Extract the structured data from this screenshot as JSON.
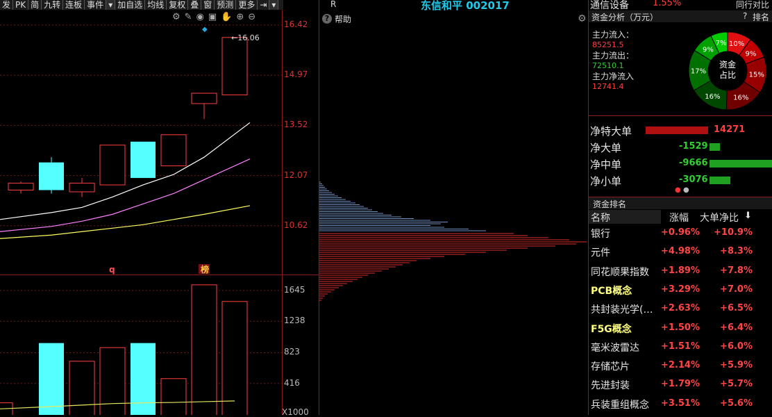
{
  "toolbar": {
    "items": [
      "发",
      "PK",
      "简",
      "九转",
      "连板",
      "事件",
      "▾",
      "加自选",
      "均线",
      "复权",
      "叠",
      "窗",
      "预测",
      "更多",
      "⇥",
      "▾"
    ]
  },
  "chart_icons": [
    "gear-icon",
    "pen-icon",
    "eye-icon",
    "trash-icon",
    "hand-icon",
    "plus-icon",
    "minus-icon"
  ],
  "chart_data": [
    {
      "type": "candlestick",
      "name": "price",
      "y_ticks": [
        "16.42",
        "14.97",
        "13.52",
        "12.07",
        "10.62"
      ],
      "ylim": [
        9.17,
        16.42
      ],
      "max_label": "16.06",
      "candles": [
        {
          "open": 11.65,
          "close": 11.85,
          "high": 11.9,
          "low": 11.55,
          "dir": "up"
        },
        {
          "open": 12.45,
          "close": 11.65,
          "high": 12.6,
          "low": 11.55,
          "dir": "down"
        },
        {
          "open": 11.6,
          "close": 11.85,
          "high": 12.0,
          "low": 11.45,
          "dir": "up"
        },
        {
          "open": 11.8,
          "close": 12.95,
          "high": 12.95,
          "low": 11.8,
          "dir": "up"
        },
        {
          "open": 13.05,
          "close": 12.0,
          "high": 13.05,
          "low": 12.0,
          "dir": "down"
        },
        {
          "open": 12.35,
          "close": 13.25,
          "high": 13.25,
          "low": 12.35,
          "dir": "up"
        },
        {
          "open": 14.15,
          "close": 14.45,
          "high": 14.45,
          "low": 13.7,
          "dir": "up"
        },
        {
          "open": 14.4,
          "close": 16.06,
          "high": 16.06,
          "low": 14.4,
          "dir": "up"
        }
      ],
      "ma_lines": [
        {
          "color": "#ffffff",
          "values": [
            10.8,
            11.0,
            11.15,
            11.45,
            11.8,
            12.1,
            12.6,
            13.6
          ],
          "x": [
            0,
            1,
            2,
            3,
            4,
            5,
            6,
            7.5
          ]
        },
        {
          "color": "#ff80ff",
          "values": [
            10.45,
            10.6,
            10.75,
            10.95,
            11.25,
            11.55,
            11.95,
            12.55
          ],
          "x": [
            0,
            1,
            2,
            3,
            4,
            5,
            6,
            7.5
          ]
        },
        {
          "color": "#ffff60",
          "values": [
            10.25,
            10.35,
            10.45,
            10.55,
            10.65,
            10.8,
            10.95,
            11.2
          ],
          "x": [
            0,
            1,
            2,
            3,
            4,
            5,
            6,
            7.5
          ]
        }
      ],
      "markers": [
        {
          "label": "q",
          "index": 3
        },
        {
          "label": "榜",
          "index": 6
        }
      ]
    },
    {
      "type": "bar",
      "name": "volume",
      "y_ticks": [
        "1645",
        "1238",
        "823",
        "416"
      ],
      "unit_label": "X1000",
      "ylim": [
        0,
        1800
      ],
      "values": [
        160,
        950,
        710,
        890,
        950,
        480,
        1720,
        1500
      ],
      "dirs": [
        "up",
        "down",
        "up",
        "up",
        "down",
        "up",
        "up",
        "up"
      ],
      "ma_values": [
        80,
        110,
        130,
        150,
        160,
        165,
        175,
        185
      ]
    },
    {
      "type": "bar",
      "name": "chip-distribution",
      "orientation": "horizontal",
      "blue": [
        2,
        4,
        6,
        8,
        11,
        14,
        18,
        22,
        27,
        32,
        38,
        45,
        52,
        58,
        64,
        70,
        76,
        84,
        92,
        104,
        118,
        136,
        160,
        185,
        175,
        160,
        180,
        215,
        240
      ],
      "red": [
        280,
        300,
        330,
        360,
        385,
        370,
        340,
        300,
        270,
        240,
        210,
        180,
        160,
        140,
        130,
        120,
        110,
        100,
        90,
        80,
        70,
        62,
        55,
        48,
        40,
        34,
        28,
        22,
        17,
        12,
        8,
        5,
        3
      ]
    }
  ],
  "middle": {
    "r_label": "R",
    "stock_title": "东信和平 002017",
    "help_label": "帮助"
  },
  "right": {
    "sector": "通信设备",
    "sector_change": "1.55%",
    "compare": "同行对比",
    "header": "资金分析（万元）",
    "help_mark": "?",
    "rank_link": "排名",
    "inflow_label": "主力流入：",
    "inflow_value": "85251.5",
    "outflow_label": "主力流出：",
    "outflow_value": "72510.1",
    "net_label": "主力净流入",
    "net_value": "12741.4",
    "donut_center": [
      "资金",
      "占比"
    ],
    "donut": [
      {
        "pct": 10,
        "label": "10%",
        "color": "#e01010"
      },
      {
        "pct": 9,
        "label": "9%",
        "color": "#c00000"
      },
      {
        "pct": 15,
        "label": "15%",
        "color": "#980000"
      },
      {
        "pct": 16,
        "label": "16%",
        "color": "#700000"
      },
      {
        "pct": 16,
        "label": "16%",
        "color": "#004800"
      },
      {
        "pct": 17,
        "label": "17%",
        "color": "#007000"
      },
      {
        "pct": 9,
        "label": "9%",
        "color": "#00a000"
      },
      {
        "pct": 7,
        "label": "7%",
        "color": "#00cc00"
      }
    ],
    "net_rows": [
      {
        "label": "净特大单",
        "value": "14271",
        "num": 14271,
        "color": "#b01010",
        "vcolor": "#ff4040"
      },
      {
        "label": "净大单",
        "value": "-1529",
        "num": -1529,
        "color": "#20a020",
        "vcolor": "#30d030"
      },
      {
        "label": "净中单",
        "value": "-9666",
        "num": -9666,
        "color": "#20a020",
        "vcolor": "#30d030"
      },
      {
        "label": "净小单",
        "value": "-3076",
        "num": -3076,
        "color": "#20a020",
        "vcolor": "#30d030"
      }
    ],
    "rank_header": "资金排名",
    "col_name": "名称",
    "col_change": "涨幅",
    "col_net": "大单净比",
    "rank_rows": [
      {
        "name": "银行",
        "change": "+0.96%",
        "net": "+10.9%",
        "highlight": false
      },
      {
        "name": "元件",
        "change": "+4.98%",
        "net": "+8.3%",
        "highlight": false
      },
      {
        "name": "同花顺果指数",
        "change": "+1.89%",
        "net": "+7.8%",
        "highlight": false
      },
      {
        "name": "PCB概念",
        "change": "+3.29%",
        "net": "+7.0%",
        "highlight": true
      },
      {
        "name": "共封装光学(…",
        "change": "+2.63%",
        "net": "+6.5%",
        "highlight": false
      },
      {
        "name": "F5G概念",
        "change": "+1.50%",
        "net": "+6.4%",
        "highlight": true
      },
      {
        "name": "毫米波雷达",
        "change": "+1.51%",
        "net": "+6.0%",
        "highlight": false
      },
      {
        "name": "存储芯片",
        "change": "+2.14%",
        "net": "+5.9%",
        "highlight": false
      },
      {
        "name": "先进封装",
        "change": "+1.79%",
        "net": "+5.7%",
        "highlight": false
      },
      {
        "name": "兵装重组概念",
        "change": "+3.51%",
        "net": "+5.6%",
        "highlight": false
      }
    ]
  }
}
